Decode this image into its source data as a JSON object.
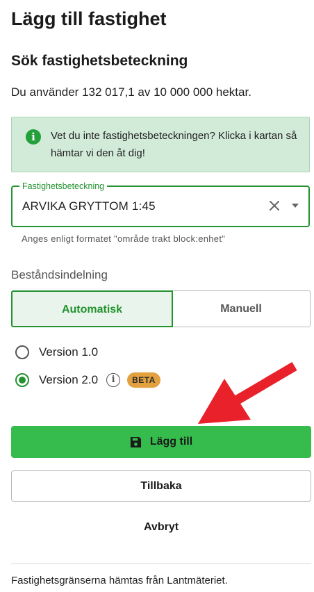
{
  "page": {
    "title": "Lägg till fastighet"
  },
  "search": {
    "section_title": "Sök fastighetsbeteckning",
    "usage_text": "Du använder 132 017,1 av 10 000 000 hektar."
  },
  "info": {
    "message": "Vet du inte fastighetsbeteckningen? Klicka i kartan så hämtar vi den åt dig!",
    "icon": "info-icon"
  },
  "field": {
    "label": "Fastighetsbeteckning",
    "value": "ARVIKA GRYTTOM 1:45",
    "helper": "Anges enligt formatet \"område trakt block:enhet\""
  },
  "division": {
    "label": "Beståndsindelning",
    "options": [
      "Automatisk",
      "Manuell"
    ],
    "selected": "Automatisk"
  },
  "versions": {
    "options": [
      {
        "label": "Version 1.0",
        "checked": false
      },
      {
        "label": "Version 2.0",
        "checked": true,
        "badge": "BETA"
      }
    ]
  },
  "actions": {
    "add_label": "Lägg till",
    "back_label": "Tillbaka",
    "cancel_label": "Avbryt"
  },
  "footer": {
    "text": "Fastighetsgränserna hämtas från Lantmäteriet."
  },
  "colors": {
    "accent": "#23922f",
    "primary_button": "#36bc4c",
    "info_bg": "#d2ead8",
    "badge": "#e2a03e",
    "annotation_arrow": "#e8212a"
  }
}
